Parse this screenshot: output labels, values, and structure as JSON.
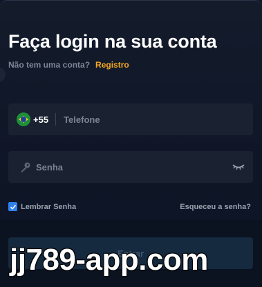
{
  "login": {
    "title": "Faça login na sua conta",
    "no_account_text": "Não tem uma conta?",
    "register_link": "Registro"
  },
  "phone": {
    "flag_icon": "brazil-flag-icon",
    "country_code": "+55",
    "placeholder": "Telefone"
  },
  "password": {
    "icon": "key-icon",
    "placeholder": "Senha",
    "toggle_icon": "eye-closed-icon"
  },
  "remember": {
    "label": "Lembrar Senha",
    "checked": true
  },
  "forgot_password": "Esqueceu a senha?",
  "submit_label": "Entrar",
  "watermark": "jj789-app.com",
  "colors": {
    "accent": "#f5a623",
    "checkbox": "#2f80ed",
    "background": "#0f1728",
    "field": "#1a2130"
  }
}
